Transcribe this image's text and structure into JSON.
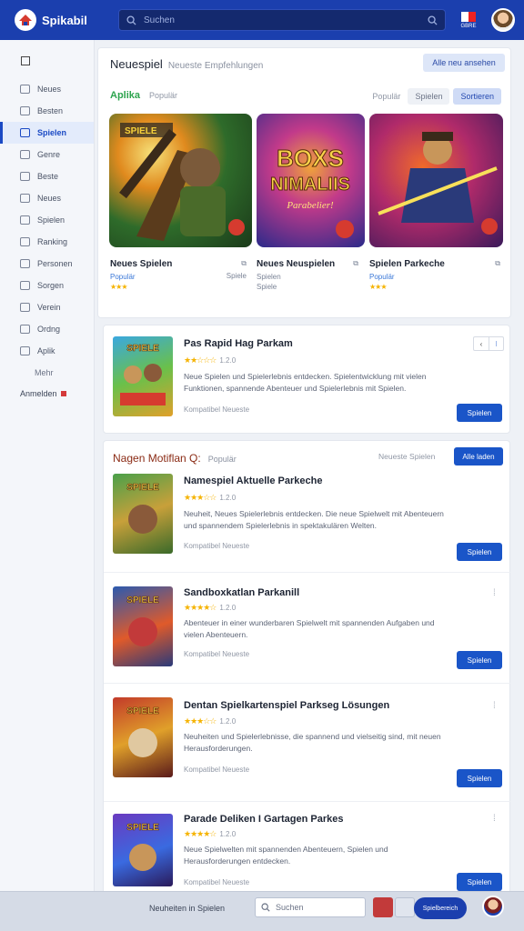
{
  "brand": {
    "name": "Spikabil"
  },
  "search": {
    "placeholder": "Suchen"
  },
  "header": {
    "flag_label": "GBRE"
  },
  "sidebar": {
    "items": [
      {
        "label": "Neues",
        "icon": "home-icon"
      },
      {
        "label": "Besten",
        "icon": "tag-icon"
      },
      {
        "label": "Spielen",
        "icon": "gamepad-icon",
        "active": true
      },
      {
        "label": "Genre",
        "icon": "grid-icon"
      },
      {
        "label": "Beste",
        "icon": "trophy-icon"
      },
      {
        "label": "Neues",
        "icon": "clock-icon"
      },
      {
        "label": "Spielen",
        "icon": "star-icon"
      },
      {
        "label": "Ranking",
        "icon": "chart-icon"
      },
      {
        "label": "Personen",
        "icon": "people-icon"
      },
      {
        "label": "Sorgen",
        "icon": "chat-icon"
      },
      {
        "label": "Verein",
        "icon": "flag-icon"
      },
      {
        "label": "Ordng",
        "icon": "list-icon"
      },
      {
        "label": "Aplik",
        "icon": "app-icon"
      }
    ],
    "plain_item": "Mehr",
    "footer_label": "Anmelden"
  },
  "page": {
    "title": "Neuespiel",
    "subtitle": "Neueste Empfehlungen",
    "top_button": "Alle neu ansehen"
  },
  "featured": {
    "section_title": "Aplika",
    "section_sub": "Populär",
    "filter_text": "Populär",
    "pill_a": "Spielen",
    "pill_b": "Sortieren",
    "tiles": [
      {
        "name": "Neues Spielen",
        "meta": "Populär",
        "side_meta": "Spiele",
        "stars": "★★★",
        "side_icon": "bookmark-icon"
      },
      {
        "name": "Neues Neuspielen",
        "meta": "Spielen",
        "meta2": "Spiele",
        "stars": "",
        "side_icon": "bookmark-icon"
      },
      {
        "name": "Spielen Parkeche",
        "meta": "Populär",
        "stars": "★★★",
        "side_icon": "bookmark-icon"
      }
    ],
    "tile2_art_line1": "BOXS",
    "tile2_art_line2": "NIMALIIS",
    "tile2_art_line3": "Parabelier!",
    "tile1_art_label": "SPIELE"
  },
  "spotlight": {
    "title": "Pas Rapid Hag Parkam",
    "stars": "★★☆☆☆",
    "rating": "1.2.0",
    "desc": "Neue Spielen und Spielerlebnis entdecken. Spielentwicklung mit vielen Funktionen, spannende Abenteuer und Spielerlebnis mit Spielen.",
    "foot": "Kompatibel Neueste",
    "button": "Spielen",
    "thumb_label": "SPIELE"
  },
  "list": {
    "title": "Nagen Motiflan Q:",
    "sub": "Populär",
    "aside": "Neueste Spielen",
    "button": "Alle laden",
    "items": [
      {
        "title": "Namespiel Aktuelle Parkeche",
        "stars": "★★★☆☆",
        "rating": "1.2.0",
        "desc": "Neuheit, Neues Spielerlebnis entdecken. Die neue Spielwelt mit Abenteuern und spannendem Spielerlebnis in spektakulären Welten.",
        "foot": "Kompatibel Neueste",
        "button": "Spielen",
        "thumb_label": "SPIELE"
      },
      {
        "title": "Sandboxkatlan Parkanill",
        "stars": "★★★★☆",
        "rating": "1.2.0",
        "desc": "Abenteuer in einer wunderbaren Spielwelt mit spannenden Aufgaben und vielen Abenteuern.",
        "foot": "Kompatibel Neueste",
        "button": "Spielen",
        "thumb_label": "SPIELE"
      },
      {
        "title": "Dentan Spielkartenspiel Parkseg Lösungen",
        "stars": "★★★☆☆",
        "rating": "1.2.0",
        "desc": "Neuheiten und Spielerlebnisse, die spannend und vielseitig sind, mit neuen Herausforderungen.",
        "foot": "Kompatibel Neueste",
        "button": "Spielen",
        "thumb_label": "SPIELE"
      },
      {
        "title": "Parade Deliken I Gartagen Parkes",
        "stars": "★★★★☆",
        "rating": "1.2.0",
        "desc": "Neue Spielwelten mit spannenden Abenteuern, Spielen und Herausforderungen entdecken.",
        "foot": "Kompatibel Neueste",
        "button": "Spielen",
        "thumb_label": "SPIELE"
      }
    ]
  },
  "bottombar": {
    "label": "Neuheiten in Spielen",
    "search_placeholder": "Suchen",
    "pill": "Spielbereich"
  },
  "colors": {
    "brand": "#1b3fae",
    "accent": "#1a55c8",
    "green": "#2da44e",
    "star": "#f5b301"
  }
}
